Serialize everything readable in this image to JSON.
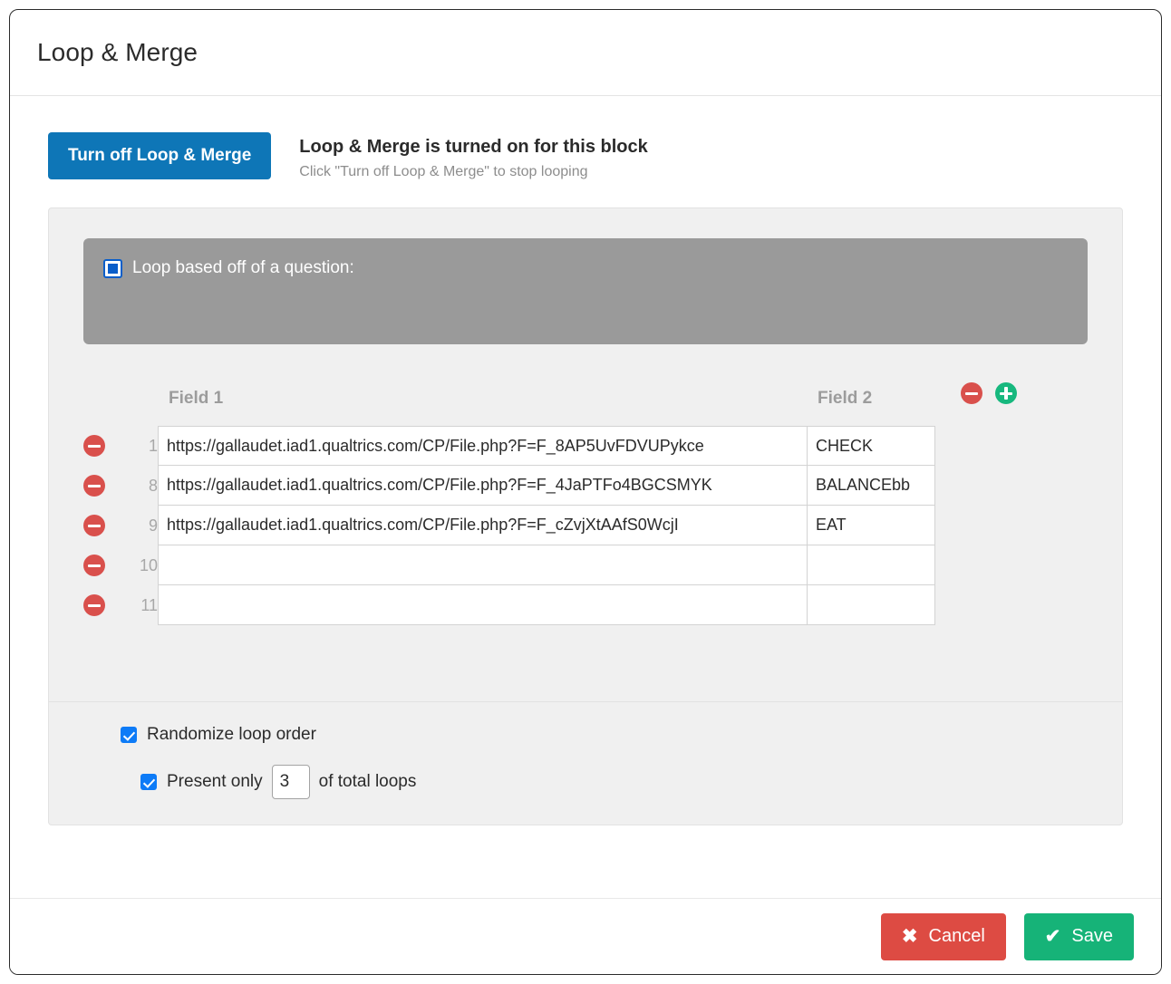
{
  "dialog": {
    "title": "Loop & Merge"
  },
  "toggle": {
    "button_label": "Turn off Loop & Merge",
    "status_title": "Loop & Merge is turned on for this block",
    "status_hint": "Click \"Turn off Loop & Merge\" to stop looping"
  },
  "question_banner": {
    "label": "Loop based off of a question:",
    "checkbox_state": "indeterminate"
  },
  "table": {
    "headers": [
      "Field 1",
      "Field 2"
    ],
    "add_icon": "plus-circle-icon",
    "remove_icon": "minus-circle-icon",
    "rows": [
      {
        "index": "1",
        "field1": "https://gallaudet.iad1.qualtrics.com/CP/File.php?F=F_8AP5UvFDVUPykce",
        "field2": "CHECK"
      },
      {
        "index": "8",
        "field1": "https://gallaudet.iad1.qualtrics.com/CP/File.php?F=F_4JaPTFo4BGCSMYK",
        "field2": "BALANCEbb"
      },
      {
        "index": "9",
        "field1": "https://gallaudet.iad1.qualtrics.com/CP/File.php?F=F_cZvjXtAAfS0WcjI",
        "field2": "EAT"
      },
      {
        "index": "10",
        "field1": "",
        "field2": ""
      },
      {
        "index": "11",
        "field1": "",
        "field2": ""
      }
    ]
  },
  "options": {
    "randomize_label": "Randomize loop order",
    "randomize_checked": true,
    "present_only_prefix": "Present only",
    "present_only_value": "3",
    "present_only_suffix": "of total loops",
    "present_only_checked": true
  },
  "footer": {
    "cancel_label": "Cancel",
    "cancel_icon": "close-x-icon",
    "save_label": "Save",
    "save_icon": "checkmark-icon"
  },
  "colors": {
    "primary_blue": "#0e76b7",
    "checkbox_blue": "#0d7bf7",
    "danger_red": "#dd4b43",
    "remove_red": "#d9504c",
    "success_green": "#16b378",
    "add_green": "#17b87e",
    "panel_gray": "#f0f0f0",
    "banner_gray": "#9a9a9a"
  }
}
